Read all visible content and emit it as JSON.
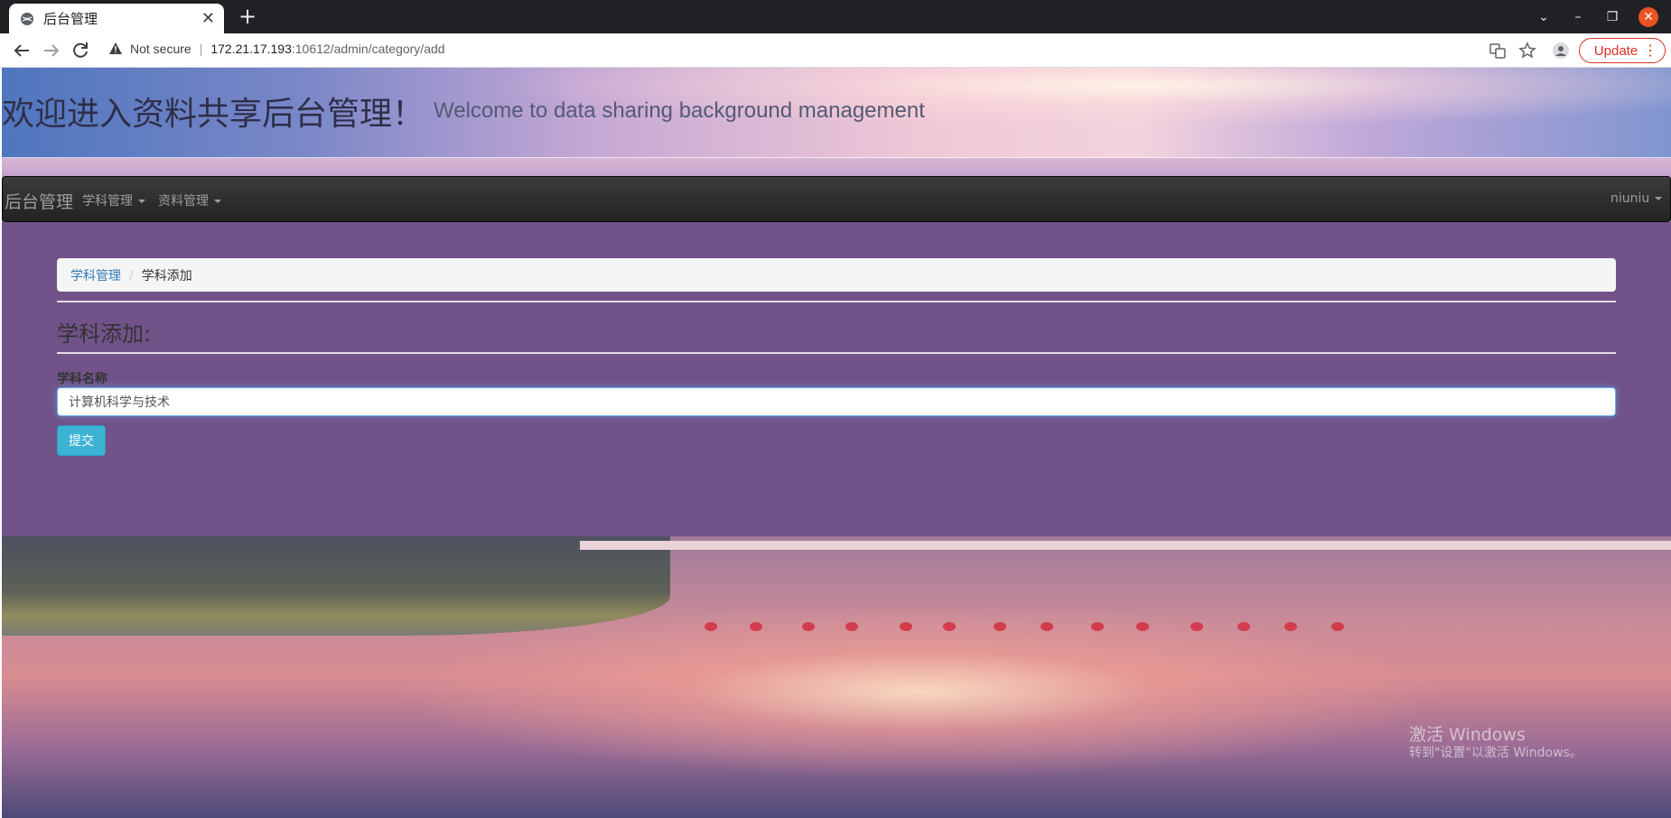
{
  "browser": {
    "tab_title": "后台管理",
    "new_tab_symbol": "+",
    "security_label": "Not secure",
    "url_host": "172.21.17.193",
    "url_rest": ":10612/admin/category/add",
    "update_label": "Update"
  },
  "header": {
    "title": "欢迎进入资料共享后台管理！",
    "subtitle": "Welcome to data sharing background management"
  },
  "navbar": {
    "brand": "后台管理",
    "menu_subject": "学科管理",
    "menu_material": "资料管理",
    "user": "niuniu"
  },
  "breadcrumb": {
    "parent": "学科管理",
    "separator": "/",
    "current": "学科添加"
  },
  "form": {
    "title": "学科添加:",
    "field_label": "学科名称",
    "field_value": "计算机科学与技术",
    "submit_label": "提交"
  },
  "watermark": {
    "line1": "激活 Windows",
    "line2": "转到\"设置\"以激活 Windows。"
  },
  "colors": {
    "panel": "#715289",
    "navbar": "#222222",
    "submit": "#3cb2d4",
    "link": "#337ab7",
    "update": "#d93025"
  }
}
